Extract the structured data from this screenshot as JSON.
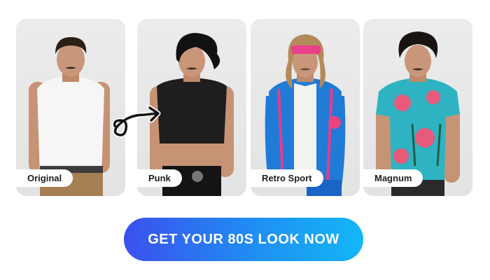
{
  "cards": [
    {
      "label": "Original"
    },
    {
      "label": "Punk"
    },
    {
      "label": "Retro Sport"
    },
    {
      "label": "Magnum"
    }
  ],
  "cta": {
    "label": "GET YOUR 80S LOOK NOW"
  },
  "colors": {
    "cta_gradient_start": "#3b50ee",
    "cta_gradient_end": "#13b7f6",
    "card_background": "#e8e8e8",
    "label_background": "#ffffff"
  },
  "icons": {
    "transform_arrow": "curly-arrow-icon"
  }
}
